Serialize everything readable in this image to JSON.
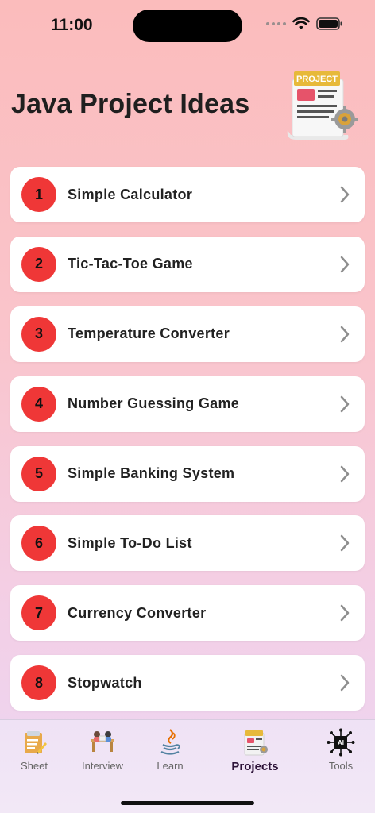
{
  "status": {
    "time": "11:00"
  },
  "page": {
    "title": "Java Project Ideas",
    "illustration_label": "PROJECT"
  },
  "items": [
    {
      "number": "1",
      "label": "Simple Calculator"
    },
    {
      "number": "2",
      "label": "Tic-Tac-Toe Game"
    },
    {
      "number": "3",
      "label": "Temperature Converter"
    },
    {
      "number": "4",
      "label": "Number Guessing Game"
    },
    {
      "number": "5",
      "label": "Simple Banking System"
    },
    {
      "number": "6",
      "label": "Simple To-Do List"
    },
    {
      "number": "7",
      "label": "Currency Converter"
    },
    {
      "number": "8",
      "label": "Stopwatch"
    }
  ],
  "tabs": [
    {
      "label": "Sheet",
      "icon": "sheet-icon"
    },
    {
      "label": "Interview",
      "icon": "interview-icon"
    },
    {
      "label": "Learn",
      "icon": "java-icon"
    },
    {
      "label": "Projects",
      "icon": "project-icon",
      "active": true
    },
    {
      "label": "Tools",
      "icon": "ai-chip-icon"
    }
  ],
  "colors": {
    "badge": "#ef3737",
    "accent_text": "#2c1238"
  }
}
